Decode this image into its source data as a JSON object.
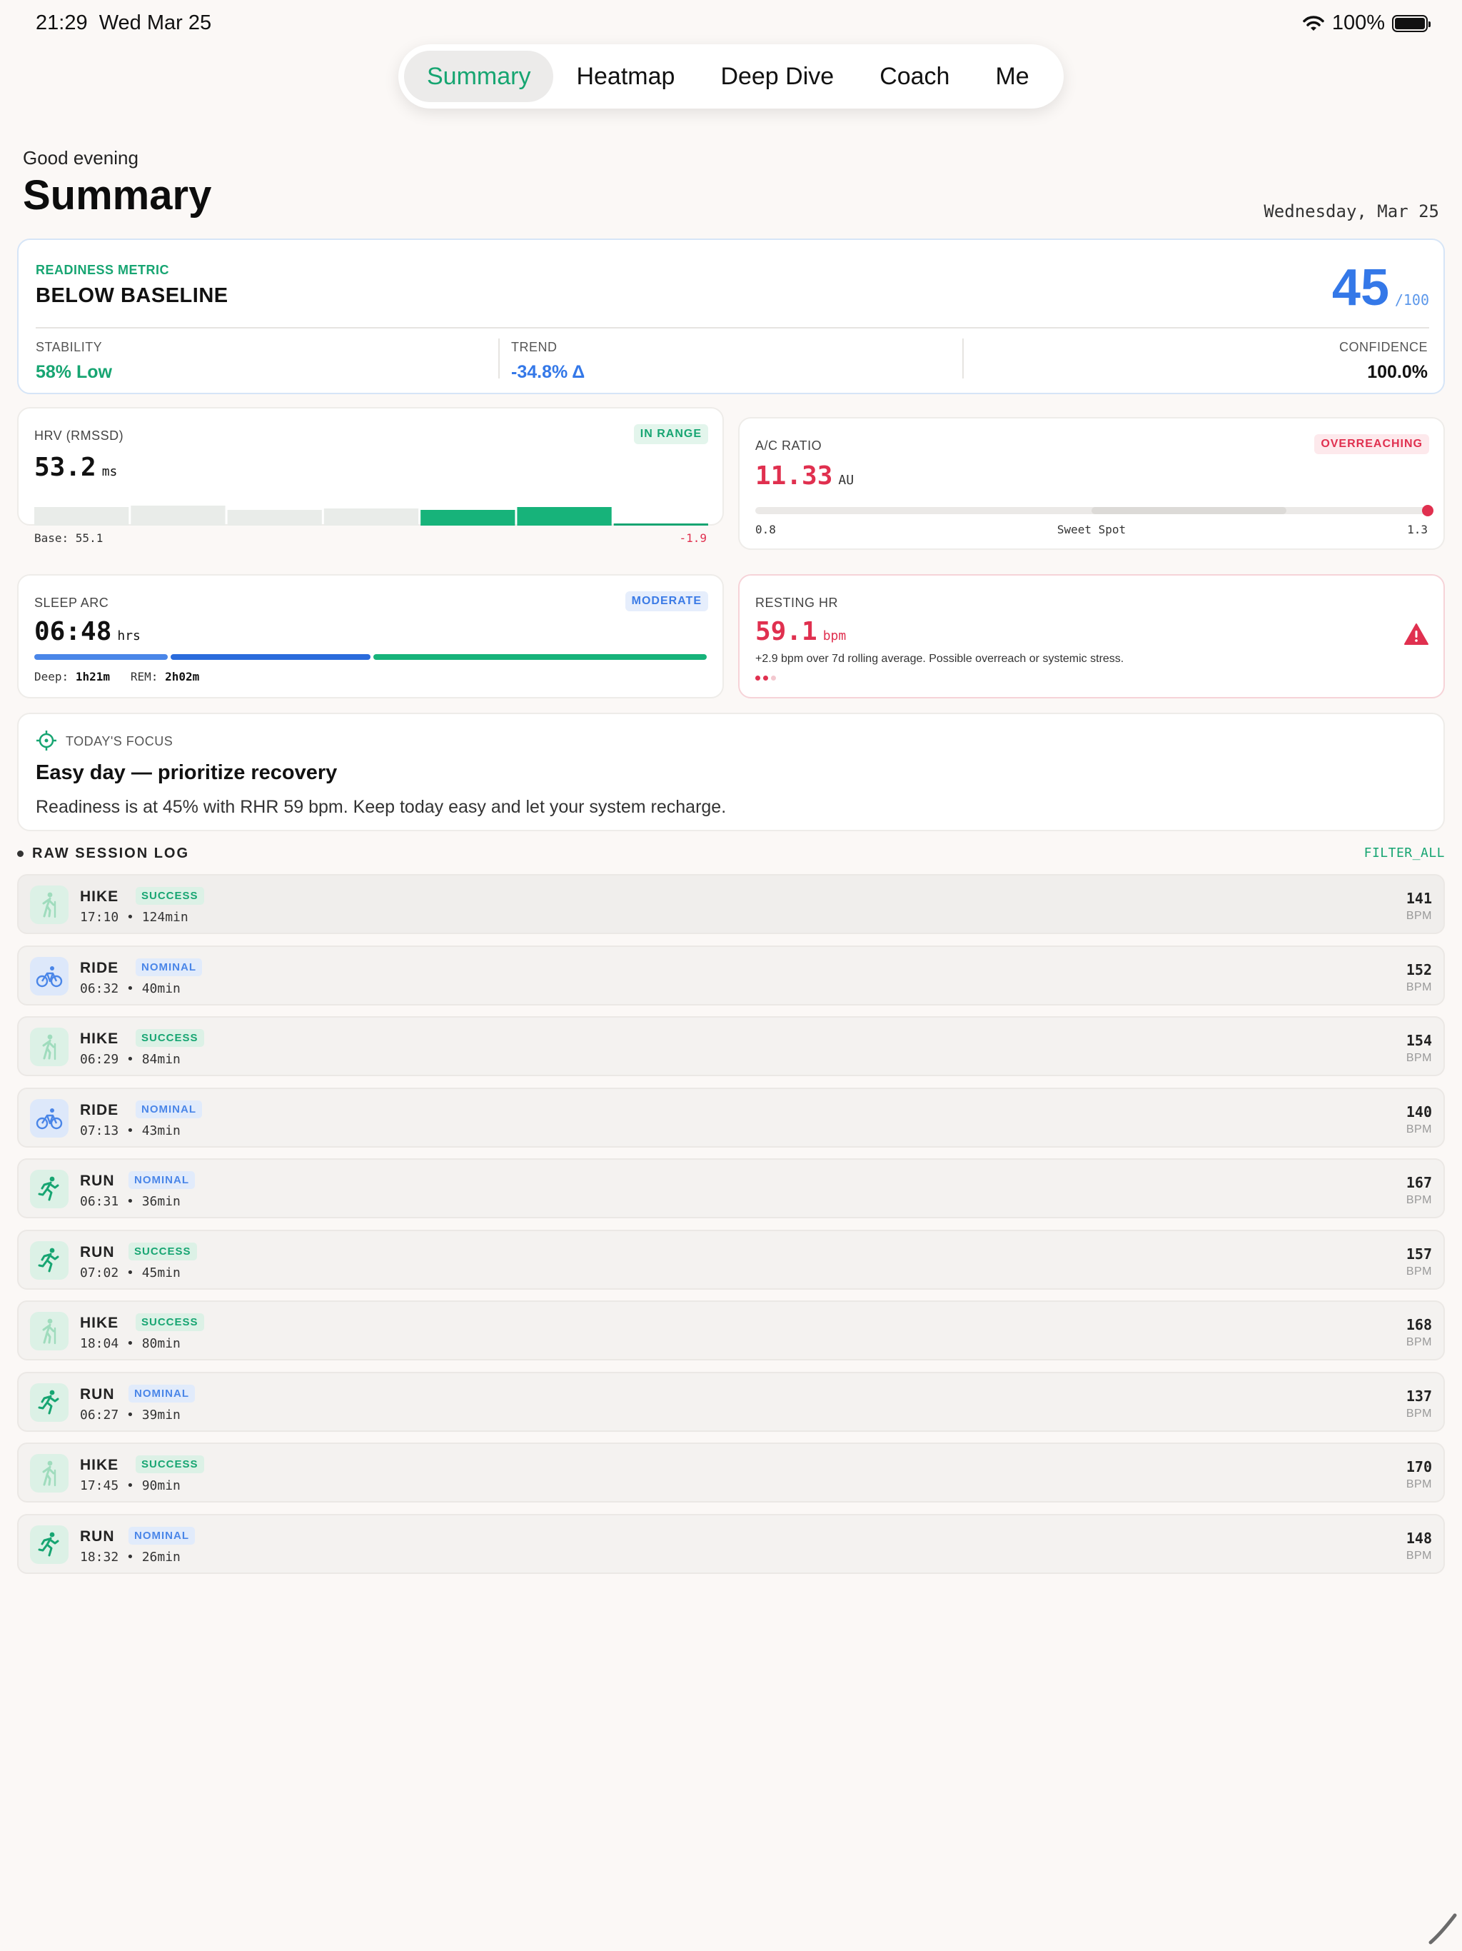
{
  "status_bar": {
    "time": "21:29",
    "date": "Wed Mar 25",
    "battery": "100%"
  },
  "tabs": [
    {
      "label": "Summary",
      "active": true
    },
    {
      "label": "Heatmap",
      "active": false
    },
    {
      "label": "Deep Dive",
      "active": false
    },
    {
      "label": "Coach",
      "active": false
    },
    {
      "label": "Me",
      "active": false
    }
  ],
  "header": {
    "greeting": "Good evening",
    "title": "Summary",
    "date": "Wednesday, Mar 25"
  },
  "readiness": {
    "kicker": "READINESS METRIC",
    "state": "BELOW BASELINE",
    "score": "45",
    "denominator": "/100",
    "stability_label": "STABILITY",
    "stability_value": "58% Low",
    "trend_label": "TREND",
    "trend_value": "-34.8% Δ",
    "confidence_label": "CONFIDENCE",
    "confidence_value": "100.0%"
  },
  "hrv": {
    "label": "HRV (RMSSD)",
    "badge": "IN RANGE",
    "value": "53.2",
    "unit": "ms",
    "base": "Base: 55.1",
    "delta": "-1.9",
    "bars": [
      0.52,
      0.56,
      0.44,
      0.48,
      0.44,
      0.52,
      0.06
    ],
    "highlighted_bars": [
      4,
      5
    ]
  },
  "acr": {
    "label": "A/C RATIO",
    "badge": "OVERREACHING",
    "value": "11.33",
    "unit": "AU",
    "scale_min": "0.8",
    "scale_mid": "Sweet Spot",
    "scale_max": "1.3",
    "position": 1.0
  },
  "sleep": {
    "label": "SLEEP ARC",
    "badge": "MODERATE",
    "value": "06:48",
    "unit": "hrs",
    "deep_label": "Deep:",
    "deep_value": "1h21m",
    "rem_label": "REM:",
    "rem_value": "2h02m",
    "segments": [
      0.2,
      0.3,
      0.5
    ]
  },
  "rhr": {
    "label": "RESTING HR",
    "value": "59.1",
    "unit": "bpm",
    "note": "+2.9 bpm over 7d rolling average. Possible overreach or systemic stress."
  },
  "focus": {
    "kicker": "TODAY'S FOCUS",
    "title": "Easy day — prioritize recovery",
    "body": "Readiness is at 45% with RHR 59 bpm. Keep today easy and let your system recharge."
  },
  "log": {
    "title": "RAW SESSION LOG",
    "filter": "FILTER_ALL",
    "bpm_unit": "BPM",
    "sessions": [
      {
        "type": "HIKE",
        "status": "SUCCESS",
        "time": "17:10",
        "duration": "124min",
        "bpm": "141"
      },
      {
        "type": "RIDE",
        "status": "NOMINAL",
        "time": "06:32",
        "duration": "40min",
        "bpm": "152"
      },
      {
        "type": "HIKE",
        "status": "SUCCESS",
        "time": "06:29",
        "duration": "84min",
        "bpm": "154"
      },
      {
        "type": "RIDE",
        "status": "NOMINAL",
        "time": "07:13",
        "duration": "43min",
        "bpm": "140"
      },
      {
        "type": "RUN",
        "status": "NOMINAL",
        "time": "06:31",
        "duration": "36min",
        "bpm": "167"
      },
      {
        "type": "RUN",
        "status": "SUCCESS",
        "time": "07:02",
        "duration": "45min",
        "bpm": "157"
      },
      {
        "type": "HIKE",
        "status": "SUCCESS",
        "time": "18:04",
        "duration": "80min",
        "bpm": "168"
      },
      {
        "type": "RUN",
        "status": "NOMINAL",
        "time": "06:27",
        "duration": "39min",
        "bpm": "137"
      },
      {
        "type": "HIKE",
        "status": "SUCCESS",
        "time": "17:45",
        "duration": "90min",
        "bpm": "170"
      },
      {
        "type": "RUN",
        "status": "NOMINAL",
        "time": "18:32",
        "duration": "26min",
        "bpm": "148"
      }
    ]
  },
  "colors": {
    "accent_green": "#17a572",
    "accent_blue": "#3478e8",
    "alert_red": "#e0304f"
  }
}
